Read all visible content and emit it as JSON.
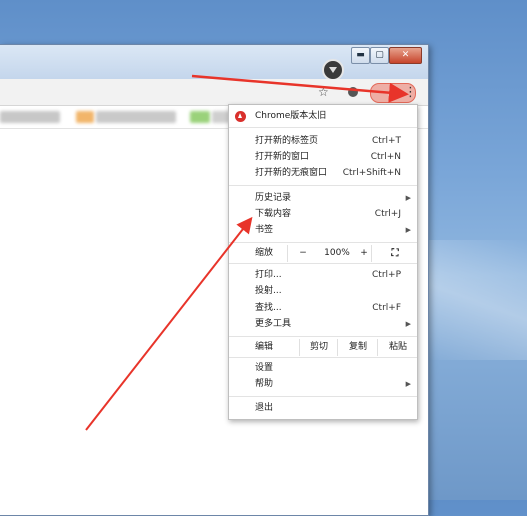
{
  "window": {
    "controls": {
      "minimize": "▬",
      "maximize": "▢",
      "close": "✕"
    }
  },
  "toolbar": {
    "star_icon": "star-icon",
    "menu_icon": "⋮"
  },
  "menu": {
    "update": "Chrome版本太旧",
    "items1": [
      {
        "label": "打开新的标签页",
        "shortcut": "Ctrl+T"
      },
      {
        "label": "打开新的窗口",
        "shortcut": "Ctrl+N"
      },
      {
        "label": "打开新的无痕窗口",
        "shortcut": "Ctrl+Shift+N"
      }
    ],
    "items2": [
      {
        "label": "历史记录",
        "shortcut": ""
      },
      {
        "label": "下载内容",
        "shortcut": "Ctrl+J"
      },
      {
        "label": "书签",
        "shortcut": ""
      }
    ],
    "zoom": {
      "label": "缩放",
      "minus": "−",
      "value": "100%",
      "plus": "+",
      "fullscreen": "⛶"
    },
    "items3": [
      {
        "label": "打印...",
        "shortcut": "Ctrl+P"
      },
      {
        "label": "投射...",
        "shortcut": ""
      },
      {
        "label": "查找...",
        "shortcut": "Ctrl+F"
      },
      {
        "label": "更多工具",
        "shortcut": ""
      }
    ],
    "edit": {
      "label": "编辑",
      "cut": "剪切",
      "copy": "复制",
      "paste": "粘贴"
    },
    "items4": [
      {
        "label": "设置"
      },
      {
        "label": "帮助"
      }
    ],
    "exit": "退出"
  },
  "colors": {
    "annotation_red": "#e8342a",
    "update_red": "#d9302c"
  }
}
